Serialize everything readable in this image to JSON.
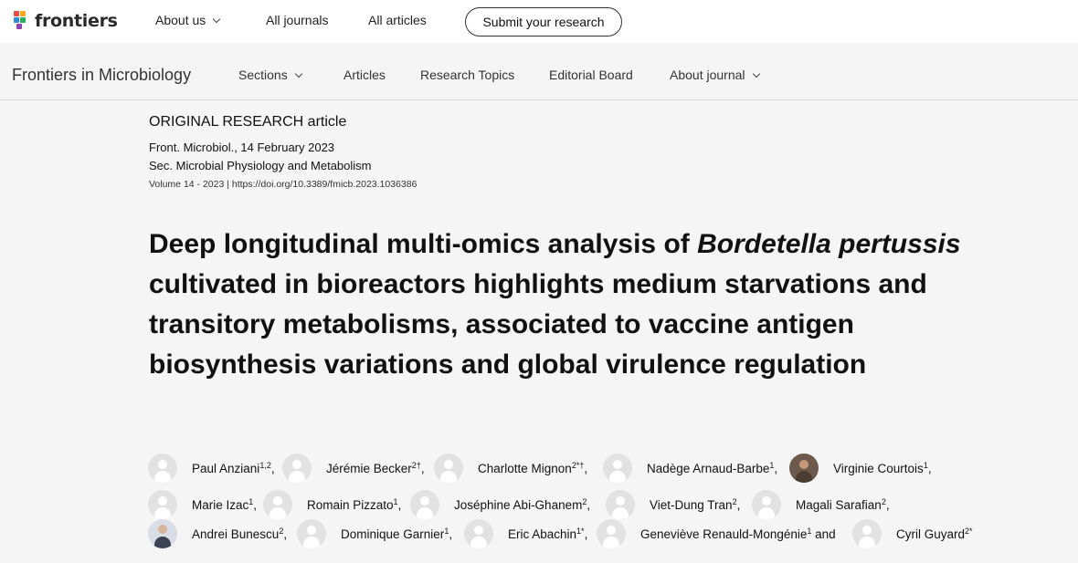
{
  "topnav": {
    "logo_text": "frontiers",
    "items": [
      "About us",
      "All journals",
      "All articles"
    ],
    "submit_label": "Submit your research"
  },
  "journalbar": {
    "journal_name": "Frontiers in Microbiology",
    "items": [
      "Sections",
      "Articles",
      "Research Topics",
      "Editorial Board",
      "About journal"
    ]
  },
  "article": {
    "type_label": "ORIGINAL RESEARCH article",
    "citation": "Front. Microbiol., 14 February 2023",
    "section": "Sec. Microbial Physiology and Metabolism",
    "volume_doi": "Volume 14 - 2023 | https://doi.org/10.3389/fmicb.2023.1036386",
    "title_part1": "Deep longitudinal multi-omics analysis of ",
    "title_italic": "Bordetella pertussis",
    "title_part2": " cultivated in bioreactors highlights medium starvations and transitory metabolisms, associated to vaccine antigen biosynthesis variations and global virulence regulation"
  },
  "authors": [
    {
      "name": "Paul Anziani",
      "sup": "1,2",
      "sep": ","
    },
    {
      "name": "Jérémie Becker",
      "sup": "2†",
      "sep": ","
    },
    {
      "name": "Charlotte Mignon",
      "sup": "2*†",
      "sep": ","
    },
    {
      "name": "Nadège Arnaud-Barbe",
      "sup": "1",
      "sep": ","
    },
    {
      "name": "Virginie Courtois",
      "sup": "1",
      "sep": ","
    },
    {
      "name": "Marie Izac",
      "sup": "1",
      "sep": ","
    },
    {
      "name": "Romain Pizzato",
      "sup": "1",
      "sep": ","
    },
    {
      "name": "Joséphine Abi-Ghanem",
      "sup": "2",
      "sep": ","
    },
    {
      "name": "Viet-Dung Tran",
      "sup": "2",
      "sep": ","
    },
    {
      "name": "Magali Sarafian",
      "sup": "2",
      "sep": ","
    },
    {
      "name": "Andrei Bunescu",
      "sup": "2",
      "sep": ","
    },
    {
      "name": "Dominique Garnier",
      "sup": "1",
      "sep": ","
    },
    {
      "name": "Eric Abachin",
      "sup": "1*",
      "sep": ","
    },
    {
      "name": "Geneviève Renauld-Mongénie",
      "sup": "1",
      "sep": " and"
    },
    {
      "name": "Cyril Guyard",
      "sup": "2*",
      "sep": ""
    }
  ],
  "colors": {
    "page_bg": "#f5f5f5",
    "logo_squares": [
      "#e84c3d",
      "#f5a623",
      "#2d8dd6",
      "#27ae60",
      "#8e44ad"
    ]
  }
}
